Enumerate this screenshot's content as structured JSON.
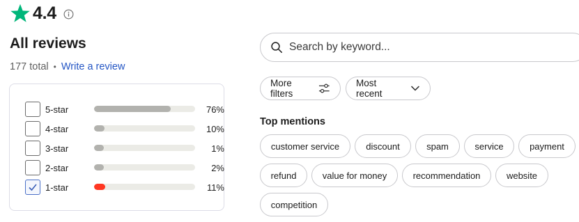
{
  "rating": {
    "score": "4.4",
    "star_color": "#00b67a"
  },
  "reviews": {
    "title": "All reviews",
    "total": "177 total",
    "separator": "•",
    "write_link": "Write a review"
  },
  "star_filters": [
    {
      "label": "5-star",
      "percent": "76%",
      "fraction": 0.76,
      "checked": false,
      "bar_color": "#b2b2ae"
    },
    {
      "label": "4-star",
      "percent": "10%",
      "fraction": 0.1,
      "checked": false,
      "bar_color": "#b2b2ae"
    },
    {
      "label": "3-star",
      "percent": "1%",
      "fraction": 0.01,
      "checked": false,
      "bar_color": "#b2b2ae"
    },
    {
      "label": "2-star",
      "percent": "2%",
      "fraction": 0.02,
      "checked": false,
      "bar_color": "#b2b2ae"
    },
    {
      "label": "1-star",
      "percent": "11%",
      "fraction": 0.11,
      "checked": true,
      "bar_color": "#ff3722"
    }
  ],
  "search": {
    "placeholder": "Search by keyword...",
    "icon": "search-icon"
  },
  "filters": {
    "more_filters": "More filters",
    "sort_label": "Most recent"
  },
  "top_mentions": {
    "title": "Top mentions",
    "items": [
      "customer service",
      "discount",
      "spam",
      "service",
      "payment",
      "refund",
      "value for money",
      "recommendation",
      "website",
      "competition"
    ]
  }
}
